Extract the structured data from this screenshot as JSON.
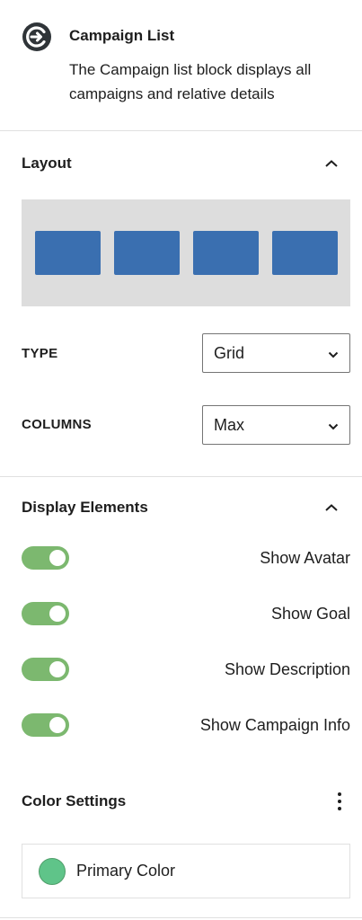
{
  "block": {
    "icon": "charitable-logo-icon",
    "title": "Campaign List",
    "description": "The Campaign list block displays all campaigns and relative details"
  },
  "layout_panel": {
    "title": "Layout",
    "expanded": true,
    "preview_box_color": "#3a6fb0",
    "preview_bg_color": "#dddddd",
    "preview_box_count": 4,
    "type_label": "TYPE",
    "type_value": "Grid",
    "columns_label": "COLUMNS",
    "columns_value": "Max"
  },
  "display_panel": {
    "title": "Display Elements",
    "expanded": true,
    "toggle_color": "#7cb86f",
    "toggles": [
      {
        "label": "Show Avatar",
        "on": true
      },
      {
        "label": "Show Goal",
        "on": true
      },
      {
        "label": "Show Description",
        "on": true
      },
      {
        "label": "Show Campaign Info",
        "on": true
      }
    ]
  },
  "color_settings": {
    "title": "Color Settings",
    "menu_icon": "more-vertical-icon",
    "items": [
      {
        "label": "Primary Color",
        "color": "#5fc489"
      }
    ]
  }
}
